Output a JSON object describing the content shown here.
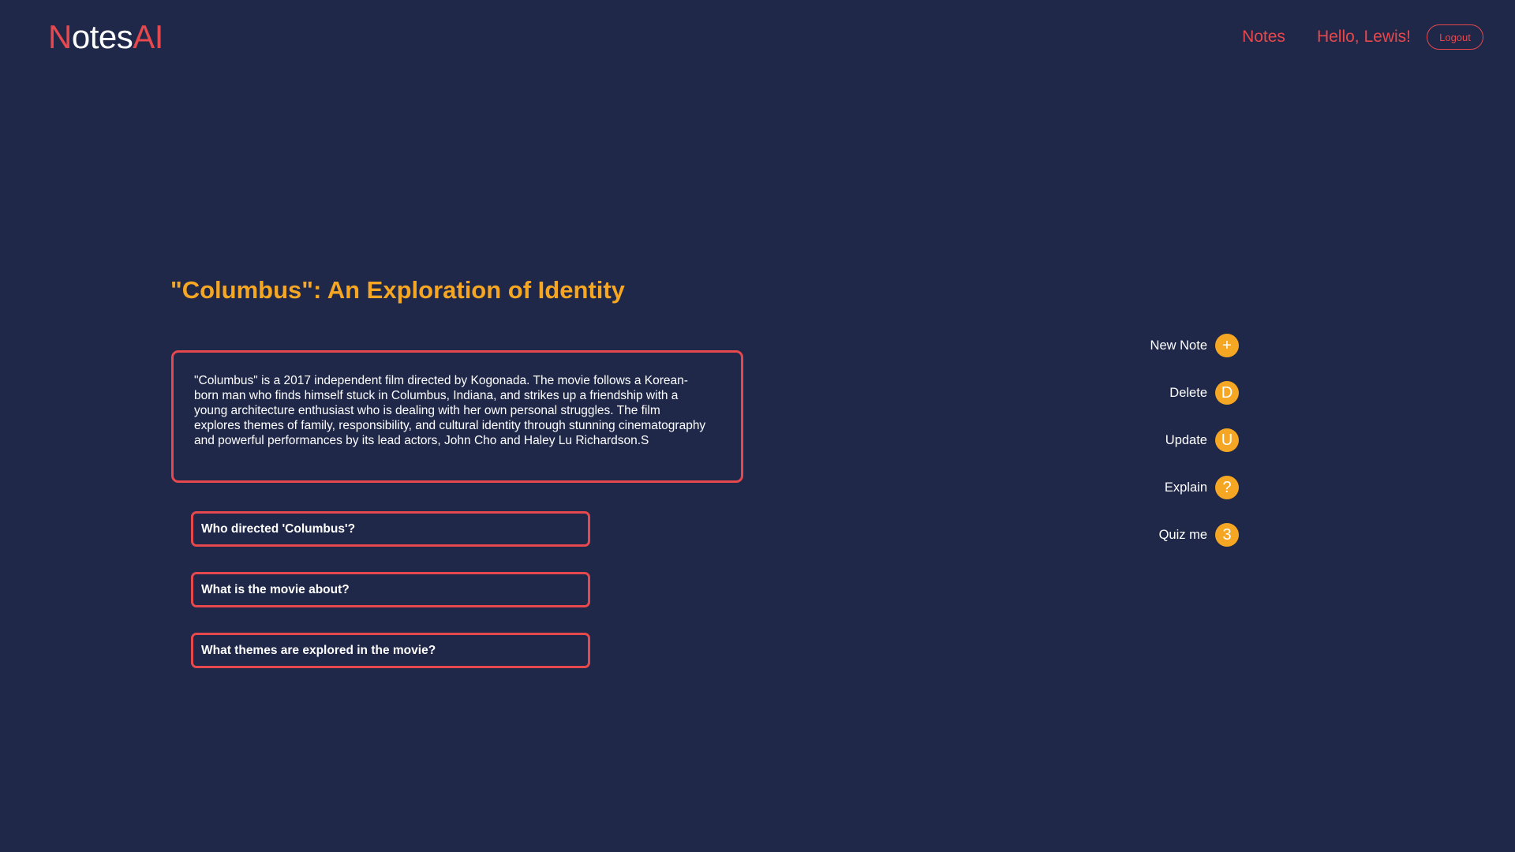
{
  "header": {
    "logo": {
      "first_letter": "N",
      "middle": "otes",
      "suffix": "AI"
    },
    "nav_notes": "Notes",
    "greeting": "Hello, Lewis!",
    "logout": "Logout"
  },
  "note": {
    "title": "\"Columbus\": An Exploration of Identity",
    "body": "\"Columbus\" is a 2017 independent film directed by Kogonada. The movie follows a Korean-born man who finds himself stuck in Columbus, Indiana, and strikes up a friendship with a young architecture enthusiast who is dealing with her own personal struggles. The film explores themes of family, responsibility, and cultural identity through stunning cinematography and powerful performances by its lead actors, John Cho and Haley Lu Richardson.S"
  },
  "questions": [
    "Who directed 'Columbus'?",
    "What is the movie about?",
    "What themes are explored in the movie?"
  ],
  "actions": [
    {
      "label": "New Note",
      "icon": "+",
      "icon_name": "plus-icon"
    },
    {
      "label": "Delete",
      "icon": "D",
      "icon_name": "delete-icon"
    },
    {
      "label": "Update",
      "icon": "U",
      "icon_name": "update-icon"
    },
    {
      "label": "Explain",
      "icon": "?",
      "icon_name": "question-icon"
    },
    {
      "label": "Quiz me",
      "icon": "3",
      "icon_name": "quiz-icon"
    }
  ],
  "colors": {
    "background": "#1f2849",
    "accent_red": "#e5484d",
    "accent_orange": "#f5a623",
    "text": "#ffffff"
  }
}
